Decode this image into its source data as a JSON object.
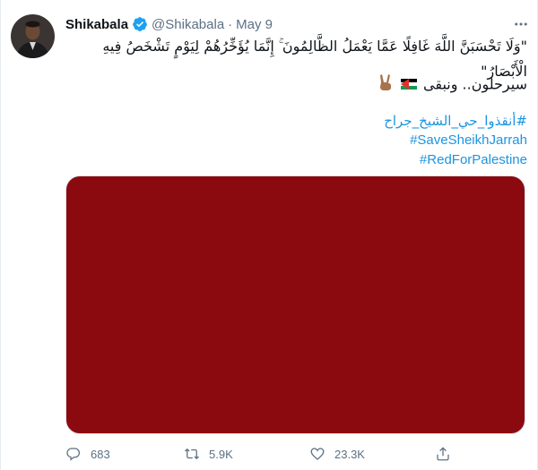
{
  "tweet": {
    "author": {
      "name": "Shikabala",
      "handle": "@Shikabala",
      "verified": true,
      "avatar_icon": "profile-photo"
    },
    "date": "May 9",
    "more_icon": "more-horizontal-icon",
    "quote_text": "\"وَلَا تَحْسَبَنَّ اللَّهَ غَافِلًا عَمَّا يَعْمَلُ الظَّالِمُونَ ۚ إِنَّمَا يُؤَخِّرُهُمْ لِيَوْمٍ تَشْخَصُ فِيهِ الْأَبْصَارُ\"",
    "line2": "سيرحلون.. ونبقى",
    "line2_emoji": [
      "palestine-flag-icon",
      "victory-hand-icon"
    ],
    "hashtags": [
      "#أنقذوا_حي_الشيخ_جراح",
      "#SaveSheikhJarrah",
      "#RedForPalestine"
    ],
    "media": {
      "color": "#8b0a10"
    },
    "actions": {
      "reply_count": "683",
      "retweet_count": "5.9K",
      "like_count": "23.3K"
    }
  },
  "colors": {
    "accent": "#1b95e0",
    "secondary_text": "#5b7083",
    "verified": "#1da1f2"
  }
}
